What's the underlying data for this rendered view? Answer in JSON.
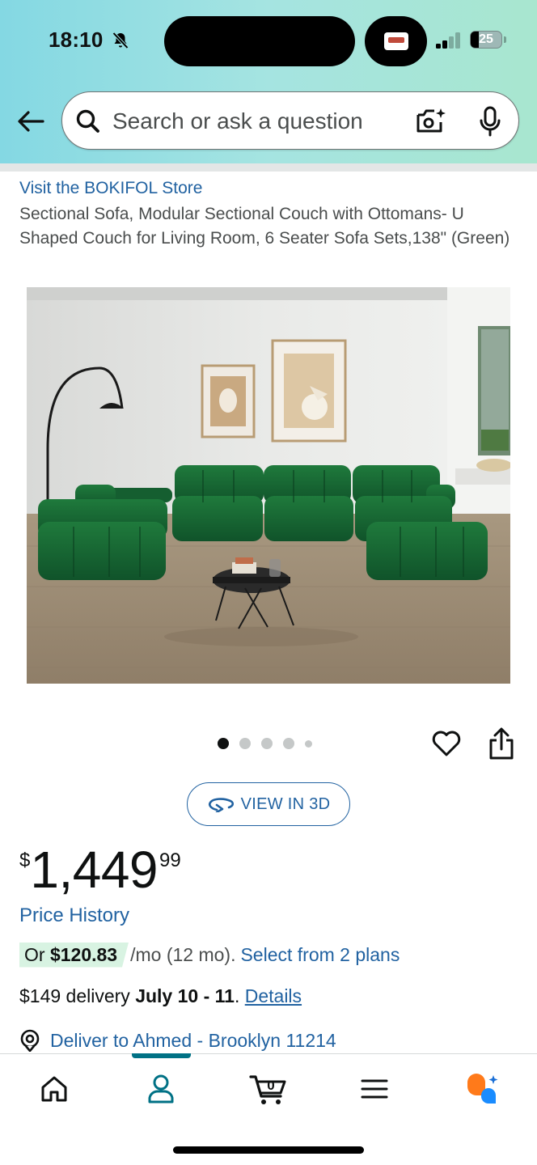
{
  "status_bar": {
    "time": "18:10",
    "battery": "25",
    "battery_level": 0.25
  },
  "search": {
    "placeholder": "Search or ask a question",
    "value": ""
  },
  "product": {
    "store_link": "Visit the BOKIFOL Store",
    "title": "Sectional Sofa, Modular Sectional Couch with Ottomans- U Shaped Couch for Living Room, 6 Seater Sofa Sets,138\" (Green)",
    "image_count": 5,
    "active_image": 1,
    "view_3d_label": "VIEW IN 3D",
    "price": {
      "symbol": "$",
      "whole": "1,449",
      "fraction": "99"
    },
    "price_history_label": "Price History",
    "installment": {
      "prefix": "Or ",
      "amount": "$120.83",
      "term": "/mo (12 mo).",
      "link": "Select from 2 plans"
    },
    "delivery": {
      "cost": "$149 delivery ",
      "dates": "July 10 - 11",
      "separator": ". ",
      "details_link": "Details"
    },
    "deliver_to": "Deliver to Ahmed - Brooklyn 11214"
  },
  "bottom_nav": {
    "items": [
      "home",
      "account",
      "cart",
      "menu",
      "rufus"
    ],
    "active": "account",
    "cart_count": "0"
  },
  "colors": {
    "link": "#2162a1",
    "sofa_green": "#1b6b34",
    "header_start": "#84d8e3",
    "header_end": "#a8e6cf",
    "installment_highlight": "#d8f3e2",
    "nav_indicator": "#007185",
    "rufus_orange": "#ff7a1a",
    "rufus_blue": "#1a8cff"
  }
}
